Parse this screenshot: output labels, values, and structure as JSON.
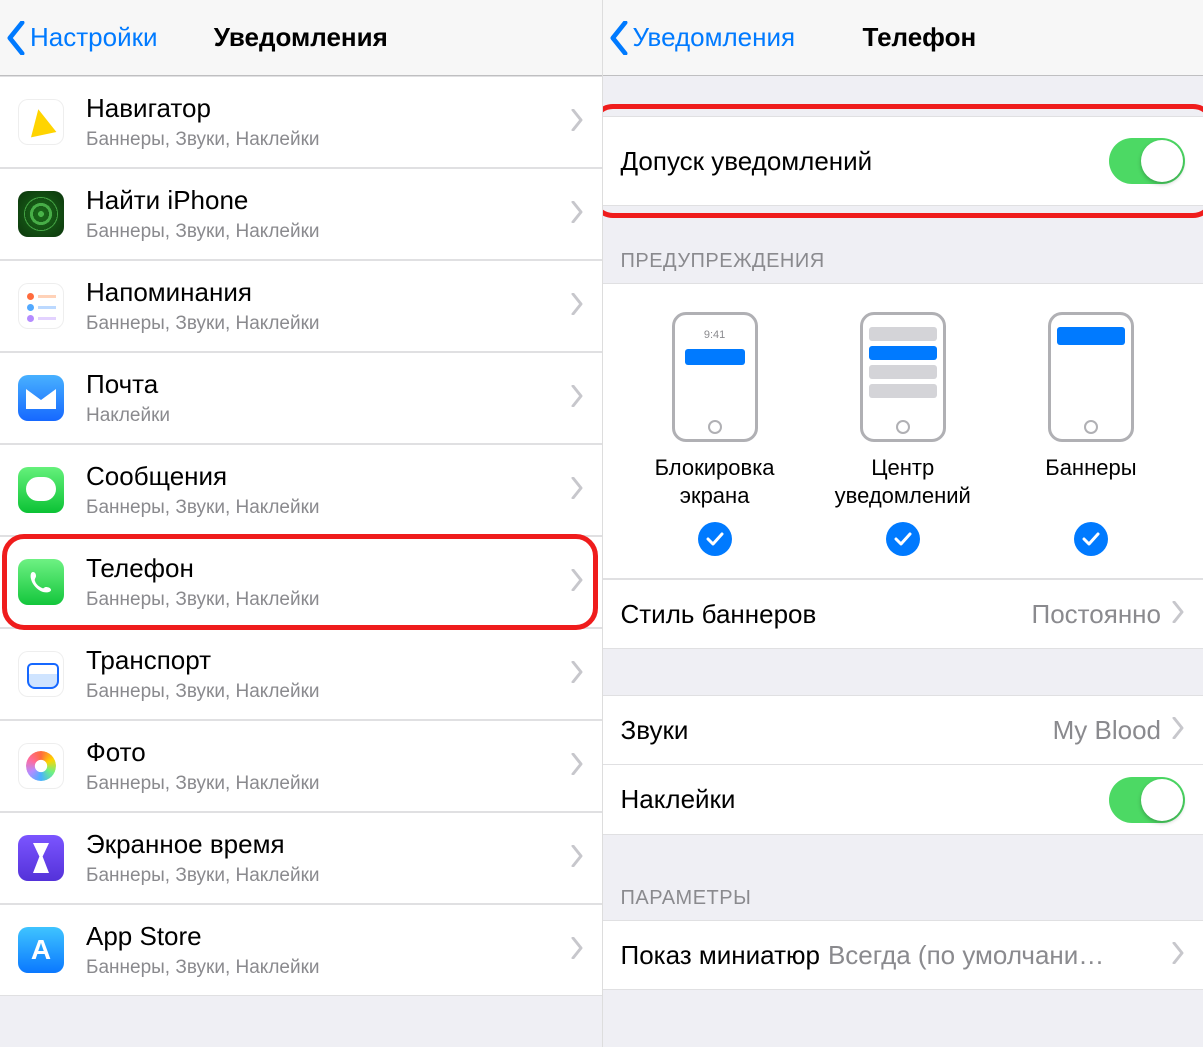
{
  "left": {
    "back": "Настройки",
    "title": "Уведомления",
    "apps": [
      {
        "name": "Навигатор",
        "detail": "Баннеры, Звуки, Наклейки",
        "ic": "nav"
      },
      {
        "name": "Найти iPhone",
        "detail": "Баннеры, Звуки, Наклейки",
        "ic": "find"
      },
      {
        "name": "Напоминания",
        "detail": "Баннеры, Звуки, Наклейки",
        "ic": "rem"
      },
      {
        "name": "Почта",
        "detail": "Наклейки",
        "ic": "mail"
      },
      {
        "name": "Сообщения",
        "detail": "Баннеры, Звуки, Наклейки",
        "ic": "msg"
      },
      {
        "name": "Телефон",
        "detail": "Баннеры, Звуки, Наклейки",
        "ic": "phone",
        "highlight": true
      },
      {
        "name": "Транспорт",
        "detail": "Баннеры, Звуки, Наклейки",
        "ic": "trans"
      },
      {
        "name": "Фото",
        "detail": "Баннеры, Звуки, Наклейки",
        "ic": "photo"
      },
      {
        "name": "Экранное время",
        "detail": "Баннеры, Звуки, Наклейки",
        "ic": "time"
      },
      {
        "name": "App Store",
        "detail": "Баннеры, Звуки, Наклейки",
        "ic": "store"
      }
    ]
  },
  "right": {
    "back": "Уведомления",
    "title": "Телефон",
    "allow": "Допуск уведомлений",
    "alerts_header": "ПРЕДУПРЕЖДЕНИЯ",
    "lock_time": "9:41",
    "alert_styles": [
      "Блокировка экрана",
      "Центр уведомлений",
      "Баннеры"
    ],
    "banner_style": {
      "label": "Стиль баннеров",
      "value": "Постоянно"
    },
    "sounds": {
      "label": "Звуки",
      "value": "My Blood"
    },
    "badges": "Наклейки",
    "params_header": "ПАРАМЕТРЫ",
    "thumb": {
      "label": "Показ миниатюр",
      "value": "Всегда (по умолчани…"
    }
  }
}
